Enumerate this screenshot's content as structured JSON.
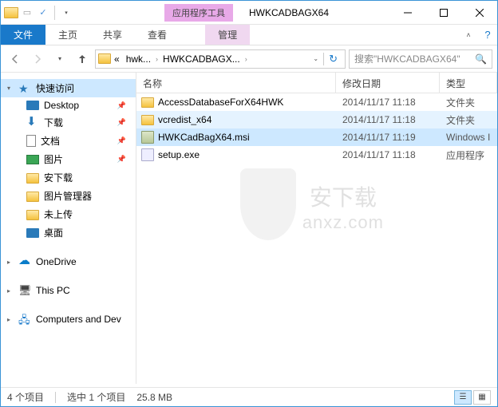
{
  "titlebar": {
    "contextual_label": "应用程序工具",
    "window_title": "HWKCADBAGX64"
  },
  "ribbon": {
    "file": "文件",
    "home": "主页",
    "share": "共享",
    "view": "查看",
    "manage": "管理"
  },
  "nav": {
    "breadcrumb_prefix": "«",
    "crumb1": "hwk...",
    "crumb2": "HWKCADBAGX...",
    "search_placeholder": "搜索\"HWKCADBAGX64\""
  },
  "sidebar": {
    "quick": "快速访问",
    "desktop": "Desktop",
    "downloads": "下载",
    "documents": "文档",
    "pictures": "图片",
    "anxiazai": "安下载",
    "picmgr": "图片管理器",
    "notuploaded": "未上传",
    "desktop_cn": "桌面",
    "onedrive": "OneDrive",
    "thispc": "This PC",
    "computers": "Computers and Dev"
  },
  "columns": {
    "name": "名称",
    "date": "修改日期",
    "type": "类型"
  },
  "files": [
    {
      "name": "AccessDatabaseForX64HWK",
      "date": "2014/11/17 11:18",
      "type": "文件夹",
      "icon": "folder",
      "state": ""
    },
    {
      "name": "vcredist_x64",
      "date": "2014/11/17 11:18",
      "type": "文件夹",
      "icon": "folder",
      "state": "hover"
    },
    {
      "name": "HWKCadBagX64.msi",
      "date": "2014/11/17 11:19",
      "type": "Windows I",
      "icon": "msi",
      "state": "selected"
    },
    {
      "name": "setup.exe",
      "date": "2014/11/17 11:18",
      "type": "应用程序",
      "icon": "exe",
      "state": ""
    }
  ],
  "watermark": {
    "text": "安下载",
    "domain": "anxz.com"
  },
  "status": {
    "count": "4 个项目",
    "selected": "选中 1 个项目",
    "size": "25.8 MB"
  }
}
